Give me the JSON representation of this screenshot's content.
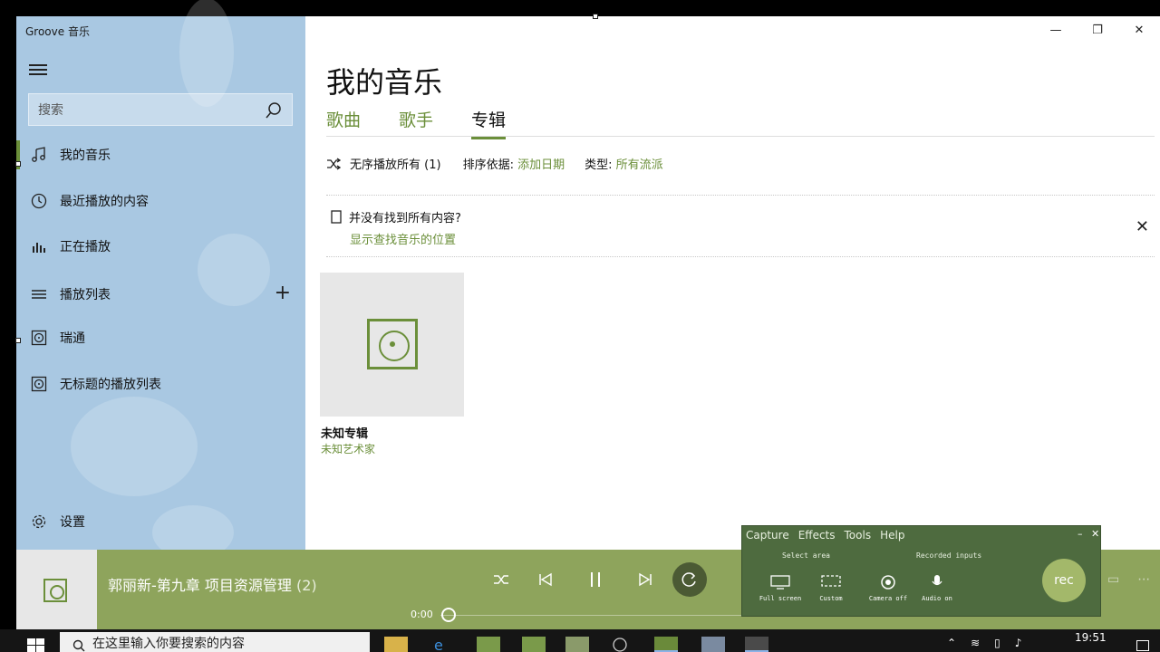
{
  "window": {
    "app_title": "Groove 音乐",
    "minimize": "—",
    "restore": "❐",
    "close": "✕"
  },
  "sidebar": {
    "search_placeholder": "搜索",
    "items": [
      {
        "label": "我的音乐",
        "icon": "music-note-icon"
      },
      {
        "label": "最近播放的内容",
        "icon": "clock-icon"
      },
      {
        "label": "正在播放",
        "icon": "equalizer-icon"
      },
      {
        "label": "播放列表",
        "icon": "playlist-icon"
      },
      {
        "label": "瑞通",
        "icon": "playlist-disc-icon"
      },
      {
        "label": "无标题的播放列表",
        "icon": "playlist-disc-icon"
      }
    ],
    "add_label": "+",
    "settings_label": "设置"
  },
  "main": {
    "title": "我的音乐",
    "tabs": [
      {
        "label": "歌曲"
      },
      {
        "label": "歌手"
      },
      {
        "label": "专辑"
      }
    ],
    "toolbar": {
      "shuffle_label": "无序播放所有 (1)",
      "sort_label": "排序依据:",
      "sort_value": "添加日期",
      "type_label": "类型:",
      "type_value": "所有流派"
    },
    "notice": {
      "question": "并没有找到所有内容?",
      "link": "显示查找音乐的位置"
    },
    "albums": [
      {
        "name": "未知专辑",
        "artist": "未知艺术家"
      }
    ]
  },
  "player": {
    "track_title": "郭丽新-第九章 项目资源管理",
    "track_count": "(2)",
    "time": "0:00",
    "progress": 0
  },
  "recorder": {
    "menu": [
      "Capture",
      "Effects",
      "Tools",
      "Help"
    ],
    "select_area": "Select area",
    "recorded_inputs": "Recorded inputs",
    "tools": [
      "Full screen",
      "Custom",
      "Camera off",
      "Audio on"
    ],
    "rec_label": "rec"
  },
  "taskbar": {
    "search_placeholder": "在这里输入你要搜索的内容",
    "time": "19:51"
  },
  "colors": {
    "accent": "#6b8f3a",
    "sidebar": "#a9c8e2",
    "player": "#8ea45c"
  }
}
